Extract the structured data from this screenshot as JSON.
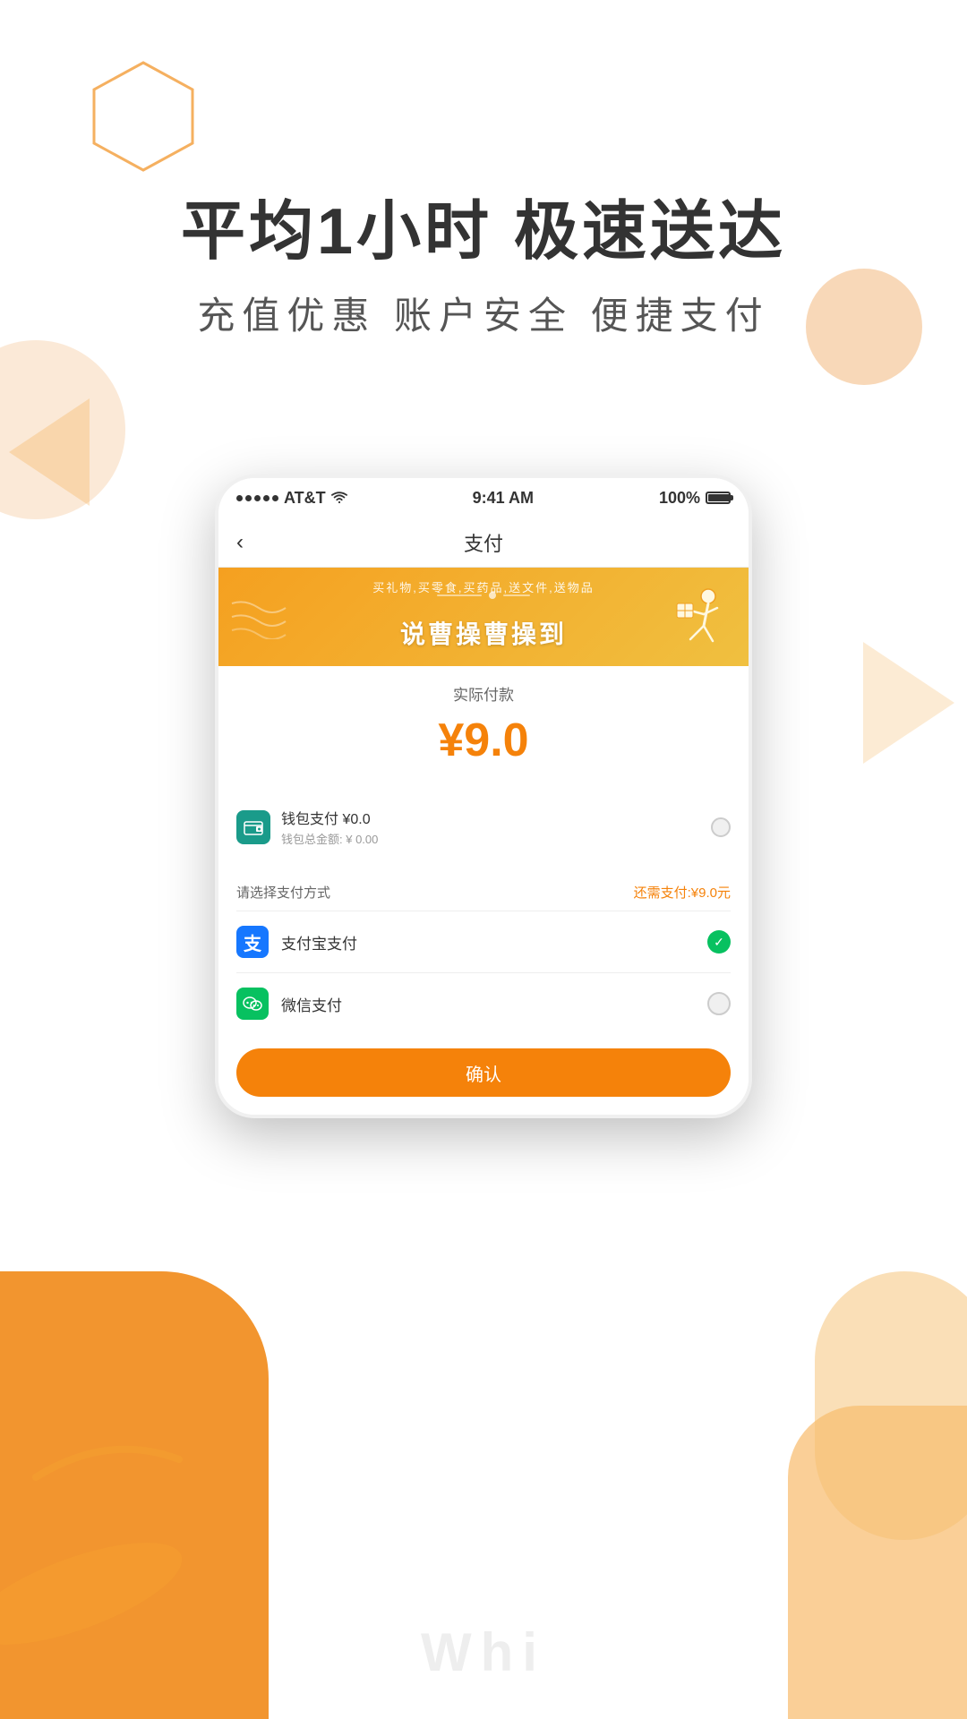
{
  "page": {
    "background_color": "#ffffff"
  },
  "header": {
    "title_line1": "平均1小时 极速送达",
    "subtitle": "充值优惠  账户安全  便捷支付"
  },
  "phone": {
    "status_bar": {
      "carrier": "AT&T",
      "time": "9:41 AM",
      "battery": "100%"
    },
    "nav": {
      "back_icon": "‹",
      "title": "支付"
    },
    "banner": {
      "small_text": "买礼物,买零食,买药品,送文件,送物品",
      "main_text": "说曹操曹操到",
      "figure": "🏃"
    },
    "payment": {
      "label": "实际付款",
      "amount": "¥9.0"
    },
    "wallet": {
      "icon": "💼",
      "name": "钱包支付 ¥0.0",
      "balance": "钱包总金额: ¥ 0.00"
    },
    "choose": {
      "label": "请选择支付方式",
      "remaining_label": "还需支付:",
      "remaining_amount": "¥9.0元",
      "options": [
        {
          "id": "alipay",
          "name": "支付宝支付",
          "selected": true
        },
        {
          "id": "wechat",
          "name": "微信支付",
          "selected": false
        }
      ]
    },
    "confirm_button": "确认"
  },
  "watermark": {
    "text": "Whi"
  },
  "icons": {
    "alipay": "支",
    "wechat": "微",
    "wallet": "💳",
    "checkmark": "✓"
  }
}
